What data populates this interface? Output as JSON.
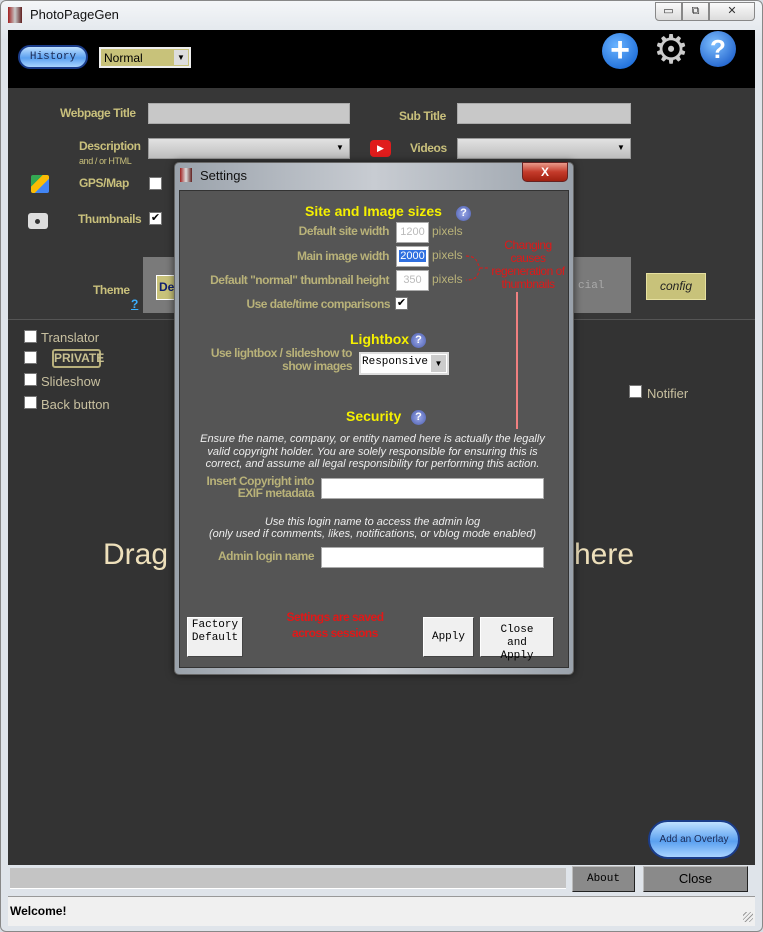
{
  "window": {
    "title": "PhotoPageGen",
    "minimize": "▭",
    "restore": "⧉",
    "close": "✕"
  },
  "header": {
    "history_label": "History",
    "mode_select": "Normal",
    "icons": [
      "plus-icon",
      "gear-icon",
      "help-icon"
    ]
  },
  "form": {
    "webpage_title_label": "Webpage Title",
    "webpage_title_value": "",
    "subtitle_label": "Sub Title",
    "subtitle_value": "",
    "description_label": "Description",
    "description_sub": "and / or HTML",
    "videos_label": "Videos",
    "gps_label": "GPS/Map",
    "gps_checked": false,
    "thumbnails_label": "Thumbnails",
    "thumbnails_checked": true,
    "theme_label": "Theme",
    "theme_help": "?",
    "theme_button": "De",
    "theme_text": "cial",
    "config_label": "config"
  },
  "options": [
    {
      "label": "Translator",
      "checked": false
    },
    {
      "label": "PRIVATE",
      "checked": false
    },
    {
      "label": "Slideshow",
      "checked": false
    },
    {
      "label": "Back button",
      "checked": false
    }
  ],
  "notifier": {
    "label": "Notifier",
    "checked": false
  },
  "drop": {
    "left": "Drag",
    "right": "here"
  },
  "bottom": {
    "overlay_label": "Add an Overlay",
    "about_label": "About",
    "close_label": "Close",
    "status": "Welcome!"
  },
  "settings": {
    "title": "Settings",
    "close": "X",
    "site_heading": "Site and Image sizes",
    "site_width_label": "Default site width",
    "site_width": "1200",
    "main_width_label": "Main image width",
    "main_width": "2000",
    "thumb_label": "Default \"normal\" thumbnail height",
    "thumb_height": "350",
    "pixels": "pixels",
    "date_label": "Use date/time comparisons",
    "date_checked": true,
    "note": "Changing causes regeneration of thumbnails",
    "lightbox_heading": "Lightbox",
    "lightbox_label": "Use lightbox / slideshow to show images",
    "lightbox_value": "Responsive",
    "security_heading": "Security",
    "security_text": "Ensure the name, company, or entity named here is actually the legally valid copyright holder.  You are solely responsible for ensuring this is correct, and assume all legal responsibility for performing this action.",
    "copyright_label": "Insert Copyright into EXIF metadata",
    "copyright_value": "",
    "login_text1": "Use this login name to access the admin log",
    "login_text2": "(only used if comments, likes, notifications, or vblog mode enabled)",
    "admin_label": "Admin login name",
    "admin_value": "",
    "factory_label": "Factory Default",
    "saved_note": "Settings are saved across sessions",
    "apply_label": "Apply",
    "close_apply_label": "Close and Apply"
  },
  "colors": {
    "label": "#c9c07c",
    "heading": "#f5f000",
    "warning": "#e01818",
    "background": "#333333"
  }
}
